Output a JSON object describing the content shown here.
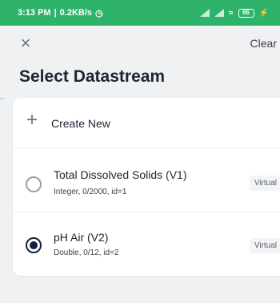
{
  "status_bar": {
    "time": "3:13 PM",
    "speed": "0.2KB/s",
    "battery": "66"
  },
  "header": {
    "close_label": "×",
    "clear_label": "Clear",
    "title": "Select Datastream"
  },
  "create": {
    "icon": "+",
    "label": "Create New"
  },
  "datastreams": [
    {
      "name": "Total Dissolved Solids (V1)",
      "meta": "Integer, 0/2000, id=1",
      "tag": "Virtual",
      "selected": false
    },
    {
      "name": "pH Air (V2)",
      "meta": "Double, 0/12, id=2",
      "tag": "Virtual",
      "selected": true
    }
  ],
  "colors": {
    "status_bar": "#2fb36a",
    "selected_radio": "#14203f",
    "background": "#f0f1f3"
  }
}
